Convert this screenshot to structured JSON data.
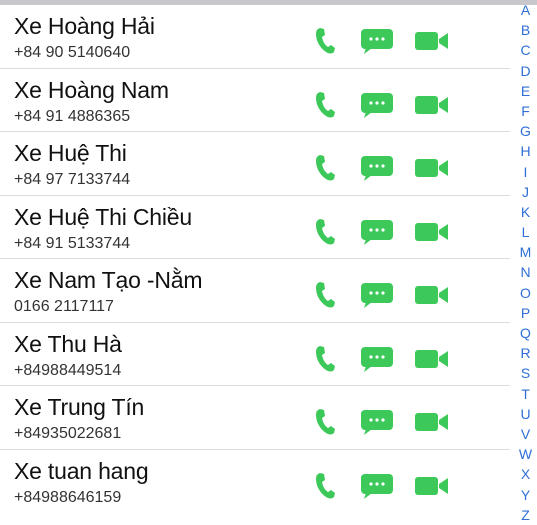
{
  "contacts": [
    {
      "name": "Xe Hoàng Hải",
      "phone": "+84 90 5140640"
    },
    {
      "name": "Xe Hoàng Nam",
      "phone": "+84 91 4886365"
    },
    {
      "name": "Xe Huệ Thi",
      "phone": "+84 97 7133744"
    },
    {
      "name": "Xe Huệ Thi Chiều",
      "phone": "+84 91 5133744"
    },
    {
      "name": "Xe Nam Tạo -Nằm",
      "phone": "0166 2117117"
    },
    {
      "name": "Xe Thu Hà",
      "phone": "+84988449514"
    },
    {
      "name": "Xe Trung Tín",
      "phone": "+84935022681"
    },
    {
      "name": "Xe tuan hang",
      "phone": "+84988646159"
    }
  ],
  "actions": {
    "call_icon": "phone-icon",
    "message_icon": "message-icon",
    "video_icon": "video-icon",
    "color": "#3cc95a"
  },
  "index_letters": [
    "A",
    "B",
    "C",
    "D",
    "E",
    "F",
    "G",
    "H",
    "I",
    "J",
    "K",
    "L",
    "M",
    "N",
    "O",
    "P",
    "Q",
    "R",
    "S",
    "T",
    "U",
    "V",
    "W",
    "X",
    "Y",
    "Z"
  ]
}
